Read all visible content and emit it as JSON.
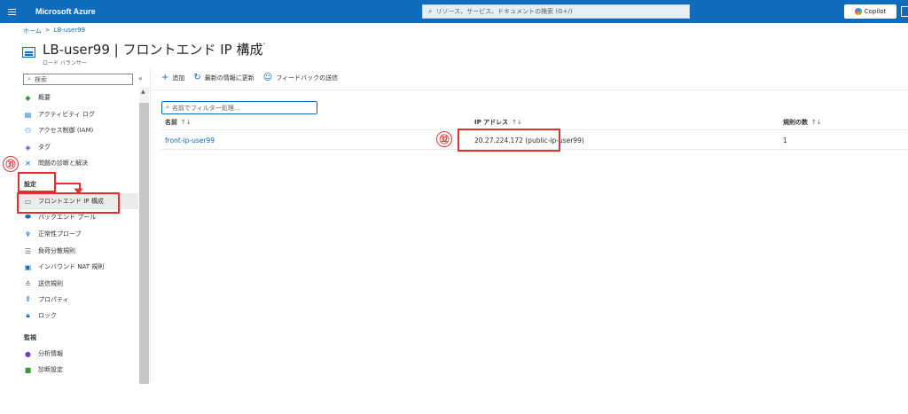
{
  "topbar": {
    "brand": "Microsoft Azure",
    "search_placeholder": "リソース、サービス、ドキュメントの検索 (G+/)",
    "copilot_label": "Copilot"
  },
  "breadcrumb": [
    "ホーム",
    "LB-user99"
  ],
  "page": {
    "title": "LB-user99 | フロントエンド IP 構成",
    "subtitle": "ロード バランサー"
  },
  "sidebar": {
    "search_placeholder": "検索",
    "items": [
      {
        "label": "概要",
        "icon": "diamond-icon",
        "color": "#3a9a3a"
      },
      {
        "label": "アクティビティ ログ",
        "icon": "activity-log-icon",
        "color": "#0f6cbd"
      },
      {
        "label": "アクセス制御 (IAM)",
        "icon": "people-icon",
        "color": "#0f6cbd"
      },
      {
        "label": "タグ",
        "icon": "tag-icon",
        "color": "#7a3cc2"
      },
      {
        "label": "問題の診断と解決",
        "icon": "wrench-icon",
        "color": "#0f6cbd"
      }
    ],
    "sections": [
      {
        "heading": "設定",
        "items": [
          {
            "label": "フロントエンド IP 構成",
            "icon": "frontend-ip-icon",
            "color": "#0f6cbd",
            "selected": true
          },
          {
            "label": "バックエンド プール",
            "icon": "backend-pool-icon",
            "color": "#0f6cbd"
          },
          {
            "label": "正常性プローブ",
            "icon": "probe-icon",
            "color": "#0f6cbd"
          },
          {
            "label": "負荷分散規則",
            "icon": "rules-icon",
            "color": "#605e5c"
          },
          {
            "label": "インバウンド NAT 規則",
            "icon": "nat-icon",
            "color": "#0f6cbd"
          },
          {
            "label": "送信規則",
            "icon": "outbound-icon",
            "color": "#605e5c"
          },
          {
            "label": "プロパティ",
            "icon": "properties-icon",
            "color": "#0f6cbd"
          },
          {
            "label": "ロック",
            "icon": "lock-icon",
            "color": "#0f6cbd"
          }
        ]
      },
      {
        "heading": "監視",
        "items": [
          {
            "label": "分析情報",
            "icon": "insights-icon",
            "color": "#7a3cc2"
          },
          {
            "label": "診断設定",
            "icon": "diagnostics-icon",
            "color": "#3a9a3a"
          }
        ]
      }
    ]
  },
  "toolbar": {
    "add": "追加",
    "refresh": "最新の情報に更新",
    "feedback": "フィードバックの送信"
  },
  "filter_placeholder": "名前でフィルター処理...",
  "table": {
    "columns": [
      "名前",
      "IP アドレス",
      "規則の数"
    ],
    "rows": [
      {
        "name": "front-ip-user99",
        "ip": "20.27.224.172 (public-ip-user99)",
        "rules": "1"
      }
    ]
  },
  "callouts": {
    "step31": "㉛",
    "step32": "㉜",
    "color": "#e23030"
  }
}
